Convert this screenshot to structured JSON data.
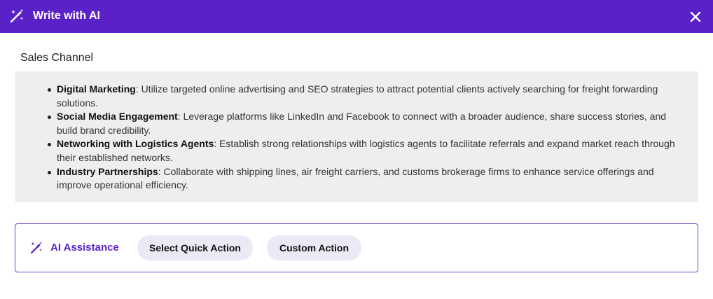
{
  "header": {
    "title": "Write with AI",
    "icon": "magic-wand-icon",
    "close_icon": "close-icon",
    "background": "#5b21c9"
  },
  "section": {
    "title": "Sales Channel"
  },
  "content": {
    "items": [
      {
        "heading": "Digital Marketing",
        "text": ": Utilize targeted online advertising and SEO strategies to attract potential clients actively searching for freight forwarding solutions."
      },
      {
        "heading": "Social Media Engagement",
        "text": ": Leverage platforms like LinkedIn and Facebook to connect with a broader audience, share success stories, and build brand credibility."
      },
      {
        "heading": "Networking with Logistics Agents",
        "text": ": Establish strong relationships with logistics agents to facilitate referrals and expand market reach through their established networks."
      },
      {
        "heading": "Industry Partnerships",
        "text": ": Collaborate with shipping lines, air freight carriers, and customs brokerage firms to enhance service offerings and improve operational efficiency."
      }
    ]
  },
  "assistance": {
    "label": "AI Assistance",
    "icon": "magic-wand-icon",
    "quick_action_label": "Select Quick Action",
    "custom_action_label": "Custom Action",
    "accent": "#5b21c9"
  }
}
